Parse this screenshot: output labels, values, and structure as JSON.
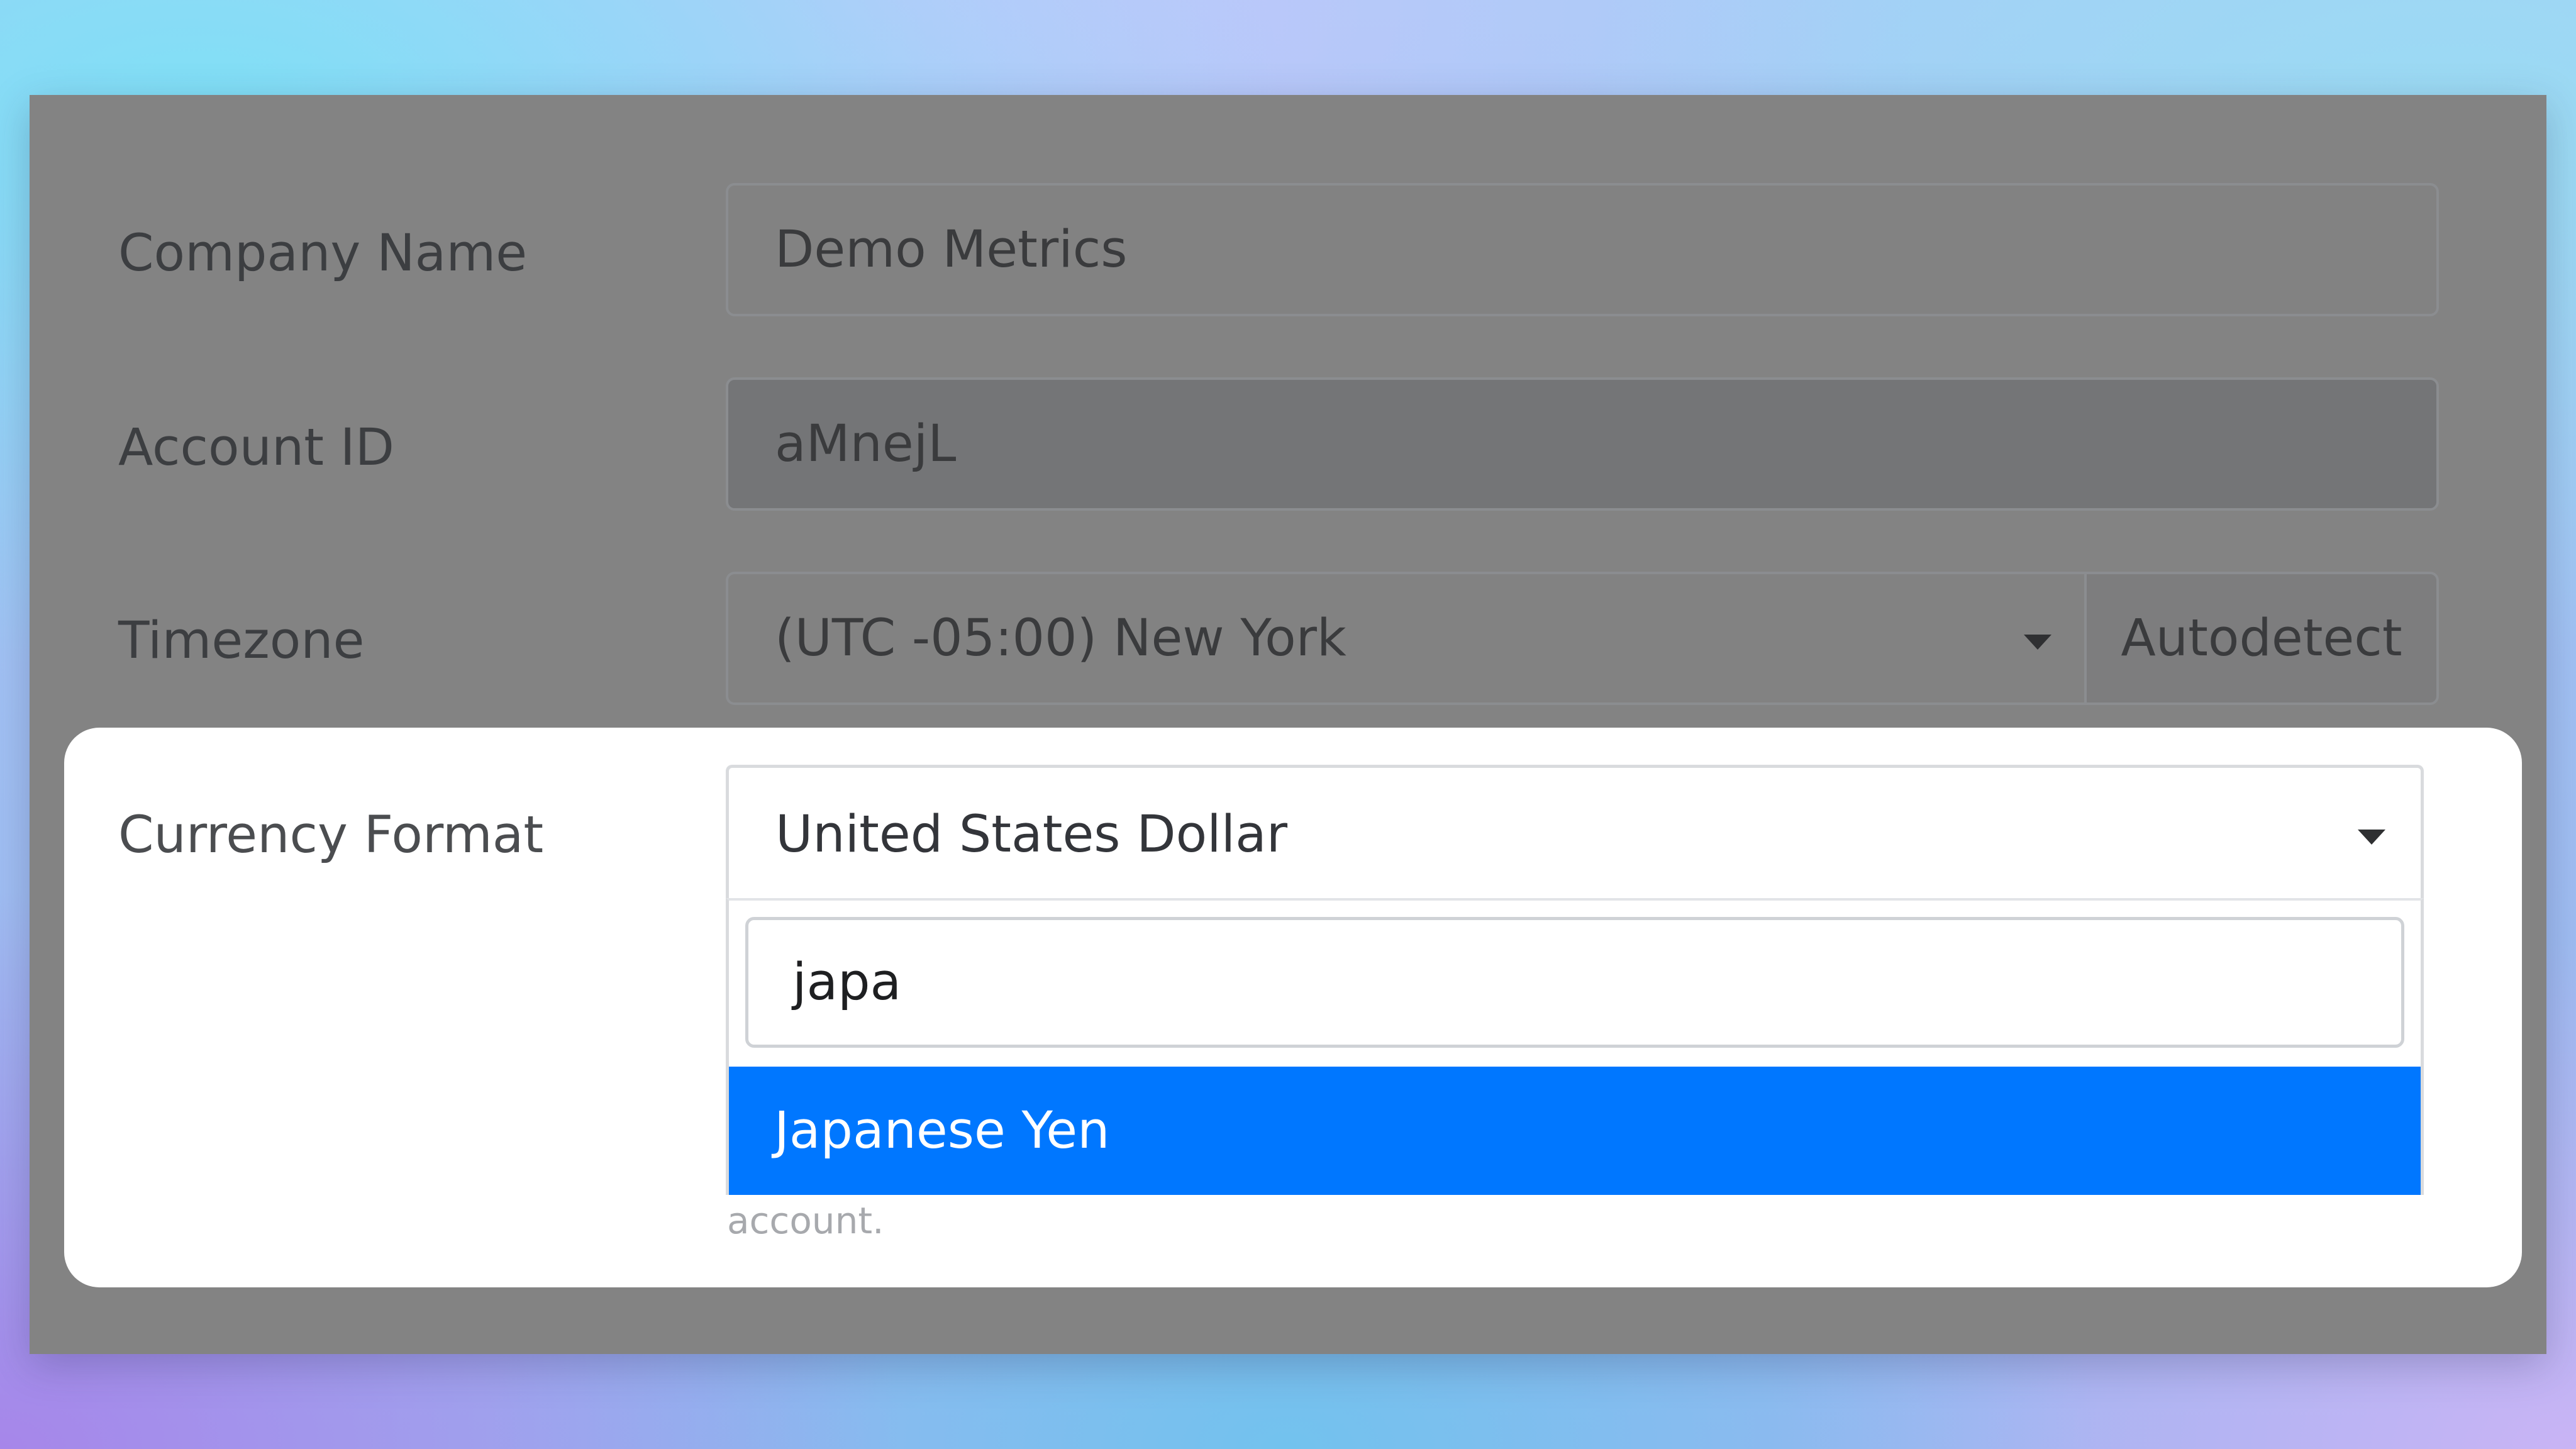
{
  "form": {
    "company_name": {
      "label": "Company Name",
      "value": "Demo Metrics"
    },
    "account_id": {
      "label": "Account ID",
      "value": "aMnejL"
    },
    "timezone": {
      "label": "Timezone",
      "value": "(UTC -05:00) New York",
      "autodetect_label": "Autodetect"
    },
    "currency": {
      "label": "Currency Format",
      "value": "United States Dollar",
      "search_value": "japa",
      "options": [
        "Japanese Yen"
      ],
      "highlighted_option": "Japanese Yen",
      "help_text_fragment": "account."
    }
  },
  "colors": {
    "accent": "#0077ff",
    "overlay": "#838383",
    "highlight_background": "#ffffff"
  },
  "icons": {
    "timezone_dropdown": "caret-down-icon",
    "currency_dropdown": "caret-down-icon"
  }
}
